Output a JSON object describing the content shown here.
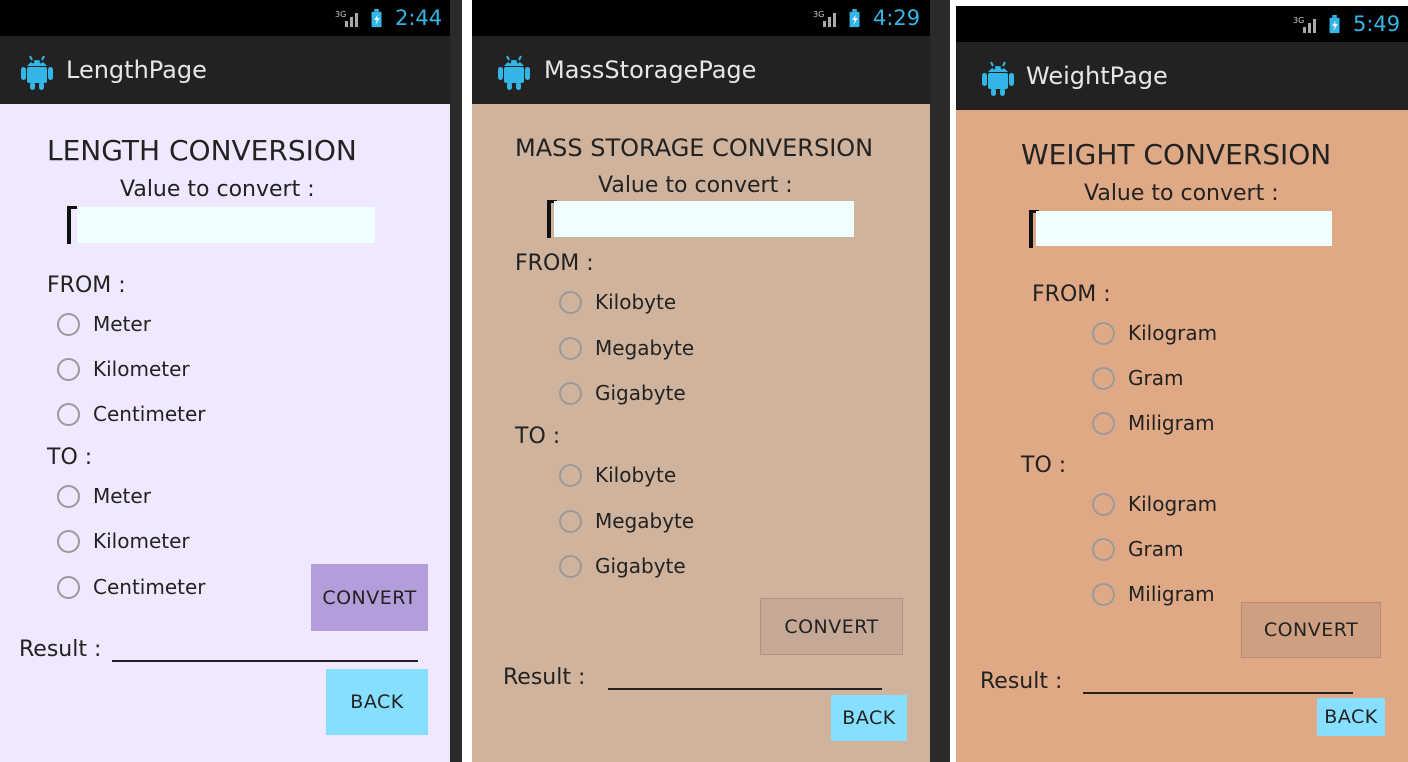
{
  "colors": {
    "status_time": "#33b5e5",
    "length_bg": "#efe8ff",
    "mass_bg": "#d0b39c",
    "weight_bg": "#dfa985",
    "length_convert_btn": "#b39ddb",
    "length_back_btn": "#87dfff",
    "mass_convert_btn": "#c5a896",
    "back_btn": "#87dfff",
    "weight_convert_btn": "#cf9f82"
  },
  "screens": [
    {
      "status_time": "2:44",
      "title": "LengthPage",
      "heading": "LENGTH CONVERSION",
      "value_label": "Value to convert :",
      "input_value": "",
      "from_label": "FROM :",
      "from_options": [
        "Meter",
        "Kilometer",
        "Centimeter"
      ],
      "to_label": "TO :",
      "to_options": [
        "Meter",
        "Kilometer",
        "Centimeter"
      ],
      "convert_label": "CONVERT",
      "result_label": "Result :",
      "back_label": "BACK"
    },
    {
      "status_time": "4:29",
      "title": "MassStoragePage",
      "heading": "MASS STORAGE CONVERSION",
      "value_label": "Value to convert :",
      "input_value": "",
      "from_label": "FROM :",
      "from_options": [
        "Kilobyte",
        "Megabyte",
        "Gigabyte"
      ],
      "to_label": "TO :",
      "to_options": [
        "Kilobyte",
        "Megabyte",
        "Gigabyte"
      ],
      "convert_label": "CONVERT",
      "result_label": "Result :",
      "back_label": "BACK"
    },
    {
      "status_time": "5:49",
      "title": "WeightPage",
      "heading": "WEIGHT CONVERSION",
      "value_label": "Value to convert :",
      "input_value": "",
      "from_label": "FROM :",
      "from_options": [
        "Kilogram",
        "Gram",
        "Miligram"
      ],
      "to_label": "TO :",
      "to_options": [
        "Kilogram",
        "Gram",
        "Miligram"
      ],
      "convert_label": "CONVERT",
      "result_label": "Result :",
      "back_label": "BACK"
    }
  ],
  "icons": {
    "app_logo": "android-icon",
    "signal": "signal-3g-icon",
    "battery": "battery-charging-icon"
  }
}
